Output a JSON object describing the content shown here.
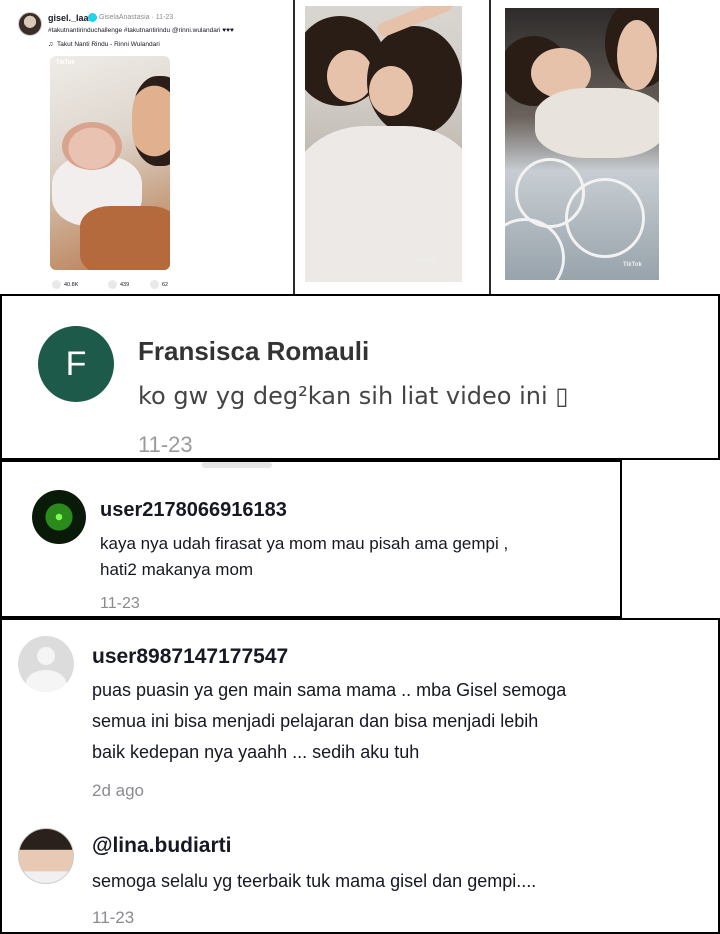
{
  "post": {
    "username": "gisel._laaa",
    "handle": "GiselaAnastasia · 11-23",
    "caption": "#takutnantirinduchallenge #takutnantirindu @rinni.wulandari ♥♥♥",
    "music": "Takut Nanti Rindu - Rinni Wulandari",
    "watermark": "TikTok",
    "likes": "40.8K",
    "comments": "439",
    "shares": "62"
  },
  "comments": [
    {
      "avatar_letter": "F",
      "avatar_color": "#1e5a4a",
      "username": "Fransisca Romauli",
      "text": "ko gw yg deg²kan sih liat video ini ▯",
      "date": "11-23"
    },
    {
      "username": "user2178066916183",
      "lines": [
        "kaya nya udah firasat ya mom mau pisah ama gempi ,",
        "hati2 makanya mom"
      ],
      "date": "11-23"
    },
    {
      "username": "user8987147177547",
      "lines": [
        "puas puasin ya gen main sama mama .. mba Gisel semoga",
        "semua ini bisa menjadi pelajaran dan bisa menjadi lebih",
        "baik kedepan nya yaahh ... sedih aku tuh"
      ],
      "date": "2d ago"
    },
    {
      "username": "@lina.budiarti",
      "lines": [
        "semoga selalu yg teerbaik tuk mama gisel dan gempi...."
      ],
      "date": "11-23"
    }
  ]
}
